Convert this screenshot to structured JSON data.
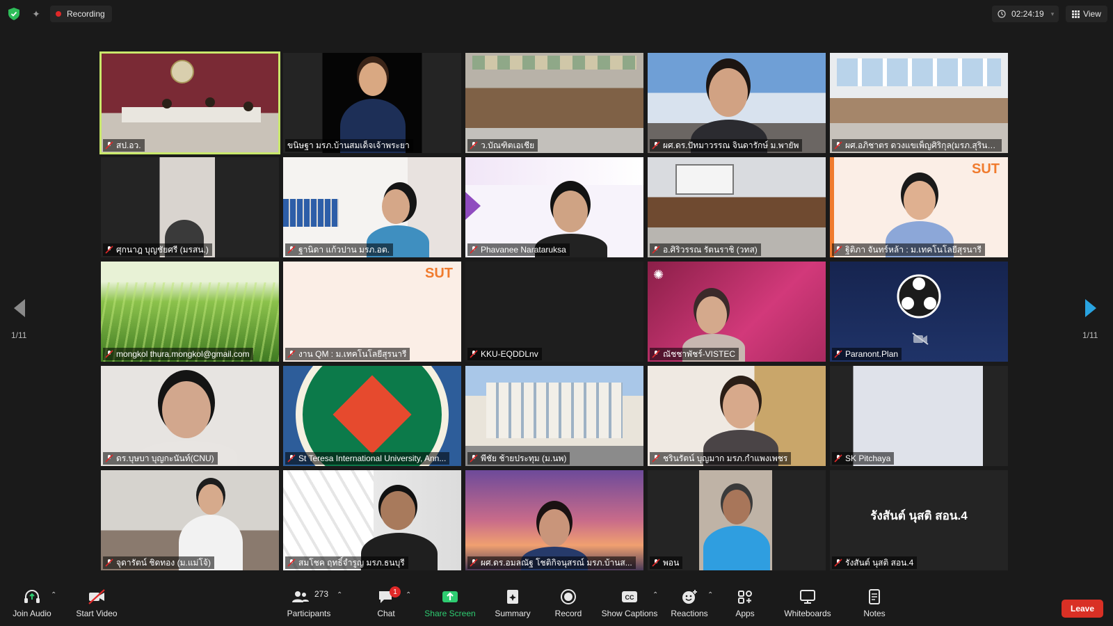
{
  "topbar": {
    "recording_label": "Recording",
    "timer": "02:24:19",
    "view_label": "View"
  },
  "pagination": {
    "left_count": "1/11",
    "right_count": "1/11"
  },
  "participants": [
    {
      "name": "สป.อว."
    },
    {
      "name": "ขนิษฐา มรภ.บ้านสมเด็จเจ้าพระยา"
    },
    {
      "name": "ว.บัณฑิตเอเชีย"
    },
    {
      "name": "ผศ.ดร.ปัทมาวรรณ จินดารักษ์ ม.พายัพ"
    },
    {
      "name": "ผศ.อภิชาตร ดวงแขเพ็ญศิริกุล(มรภ.สุรินท..."
    },
    {
      "name": "ศุกนาฎ บุญชัยศรี (มรสน.)"
    },
    {
      "name": "ฐานิดา แก้วปาน มรภ.อต."
    },
    {
      "name": "Phavanee Narataruksa"
    },
    {
      "name": "อ.ศิริวรรณ รัตนราชิ (วทส)"
    },
    {
      "name": "ฐิติภา จันทร์หล้า : ม.เทคโนโลยีสุรนารี"
    },
    {
      "name": "mongkol thura.mongkol@gmail.com"
    },
    {
      "name": "งาน QM : ม.เทคโนโลยีสุรนารี"
    },
    {
      "name": "KKU-EQDDLnv"
    },
    {
      "name": "ณัชชาพัชร์-VISTEC"
    },
    {
      "name": "Paranont.Plan"
    },
    {
      "name": "ดร.บุษบา บุญกะนันท์(CNU)"
    },
    {
      "name": "St Teresa International University, Ann..."
    },
    {
      "name": "พีชัย ช้ายประทุม (ม.นพ)"
    },
    {
      "name": "ชรินรัตน์ บุญมาก มรภ.กำแพงเพชร"
    },
    {
      "name": "SK Pitchaya"
    },
    {
      "name": "จุดารัตน์ ชิดทอง (ม.แม่โจ้)"
    },
    {
      "name": "สมโชค ฤทธิ์จำรูญ มรภ.ธนบุรี"
    },
    {
      "name": "ผศ.ดร.อมลณัฐ โชติกิจนุสรณ์ มรภ.บ้านส..."
    },
    {
      "name": "พอน"
    },
    {
      "name": "รังสันต์ นุสติ สอน.4",
      "center_name": "รังสันต์ นุสติ สอน.4"
    }
  ],
  "tile_logos": {
    "sut_a": "SUT",
    "sut_b": "SUT"
  },
  "toolbar": {
    "join_audio": "Join Audio",
    "start_video": "Start Video",
    "participants": "Participants",
    "participants_count": "273",
    "chat": "Chat",
    "chat_badge": "1",
    "share_screen": "Share Screen",
    "summary": "Summary",
    "record": "Record",
    "show_captions": "Show Captions",
    "reactions": "Reactions",
    "apps": "Apps",
    "whiteboards": "Whiteboards",
    "notes": "Notes",
    "leave": "Leave"
  },
  "colors": {
    "background": "#1a1a1a",
    "active_speaker_border": "#c9e86b",
    "recording_dot": "#e02828",
    "share_green": "#2ecc71",
    "leave_red": "#d93025",
    "page_arrow": "#29a3e0"
  }
}
